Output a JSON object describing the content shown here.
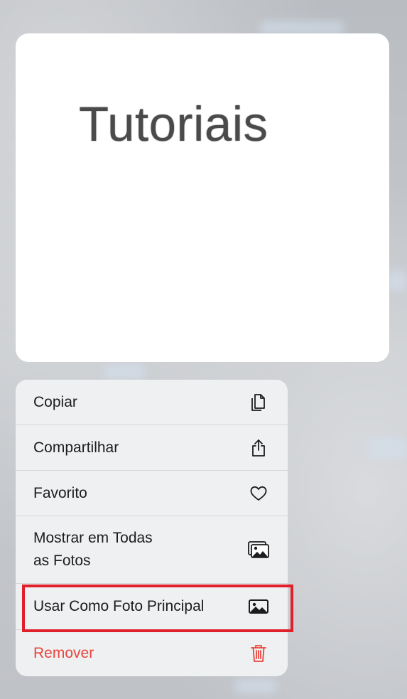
{
  "preview": {
    "text": "Tutoriais"
  },
  "menu": {
    "items": [
      {
        "label": "Copiar",
        "icon": "copy-icon"
      },
      {
        "label": "Compartilhar",
        "icon": "share-icon"
      },
      {
        "label": "Favorito",
        "icon": "heart-icon"
      },
      {
        "label_line1": "Mostrar em Todas",
        "label_line2": "as Fotos",
        "icon": "photo-stack-icon"
      },
      {
        "label": "Usar Como Foto Principal",
        "icon": "photo-icon"
      },
      {
        "label": "Remover",
        "icon": "trash-icon"
      }
    ]
  },
  "colors": {
    "destructive": "#e8453c",
    "highlight_border": "#e0202a",
    "menu_background": "#eef0f2"
  }
}
